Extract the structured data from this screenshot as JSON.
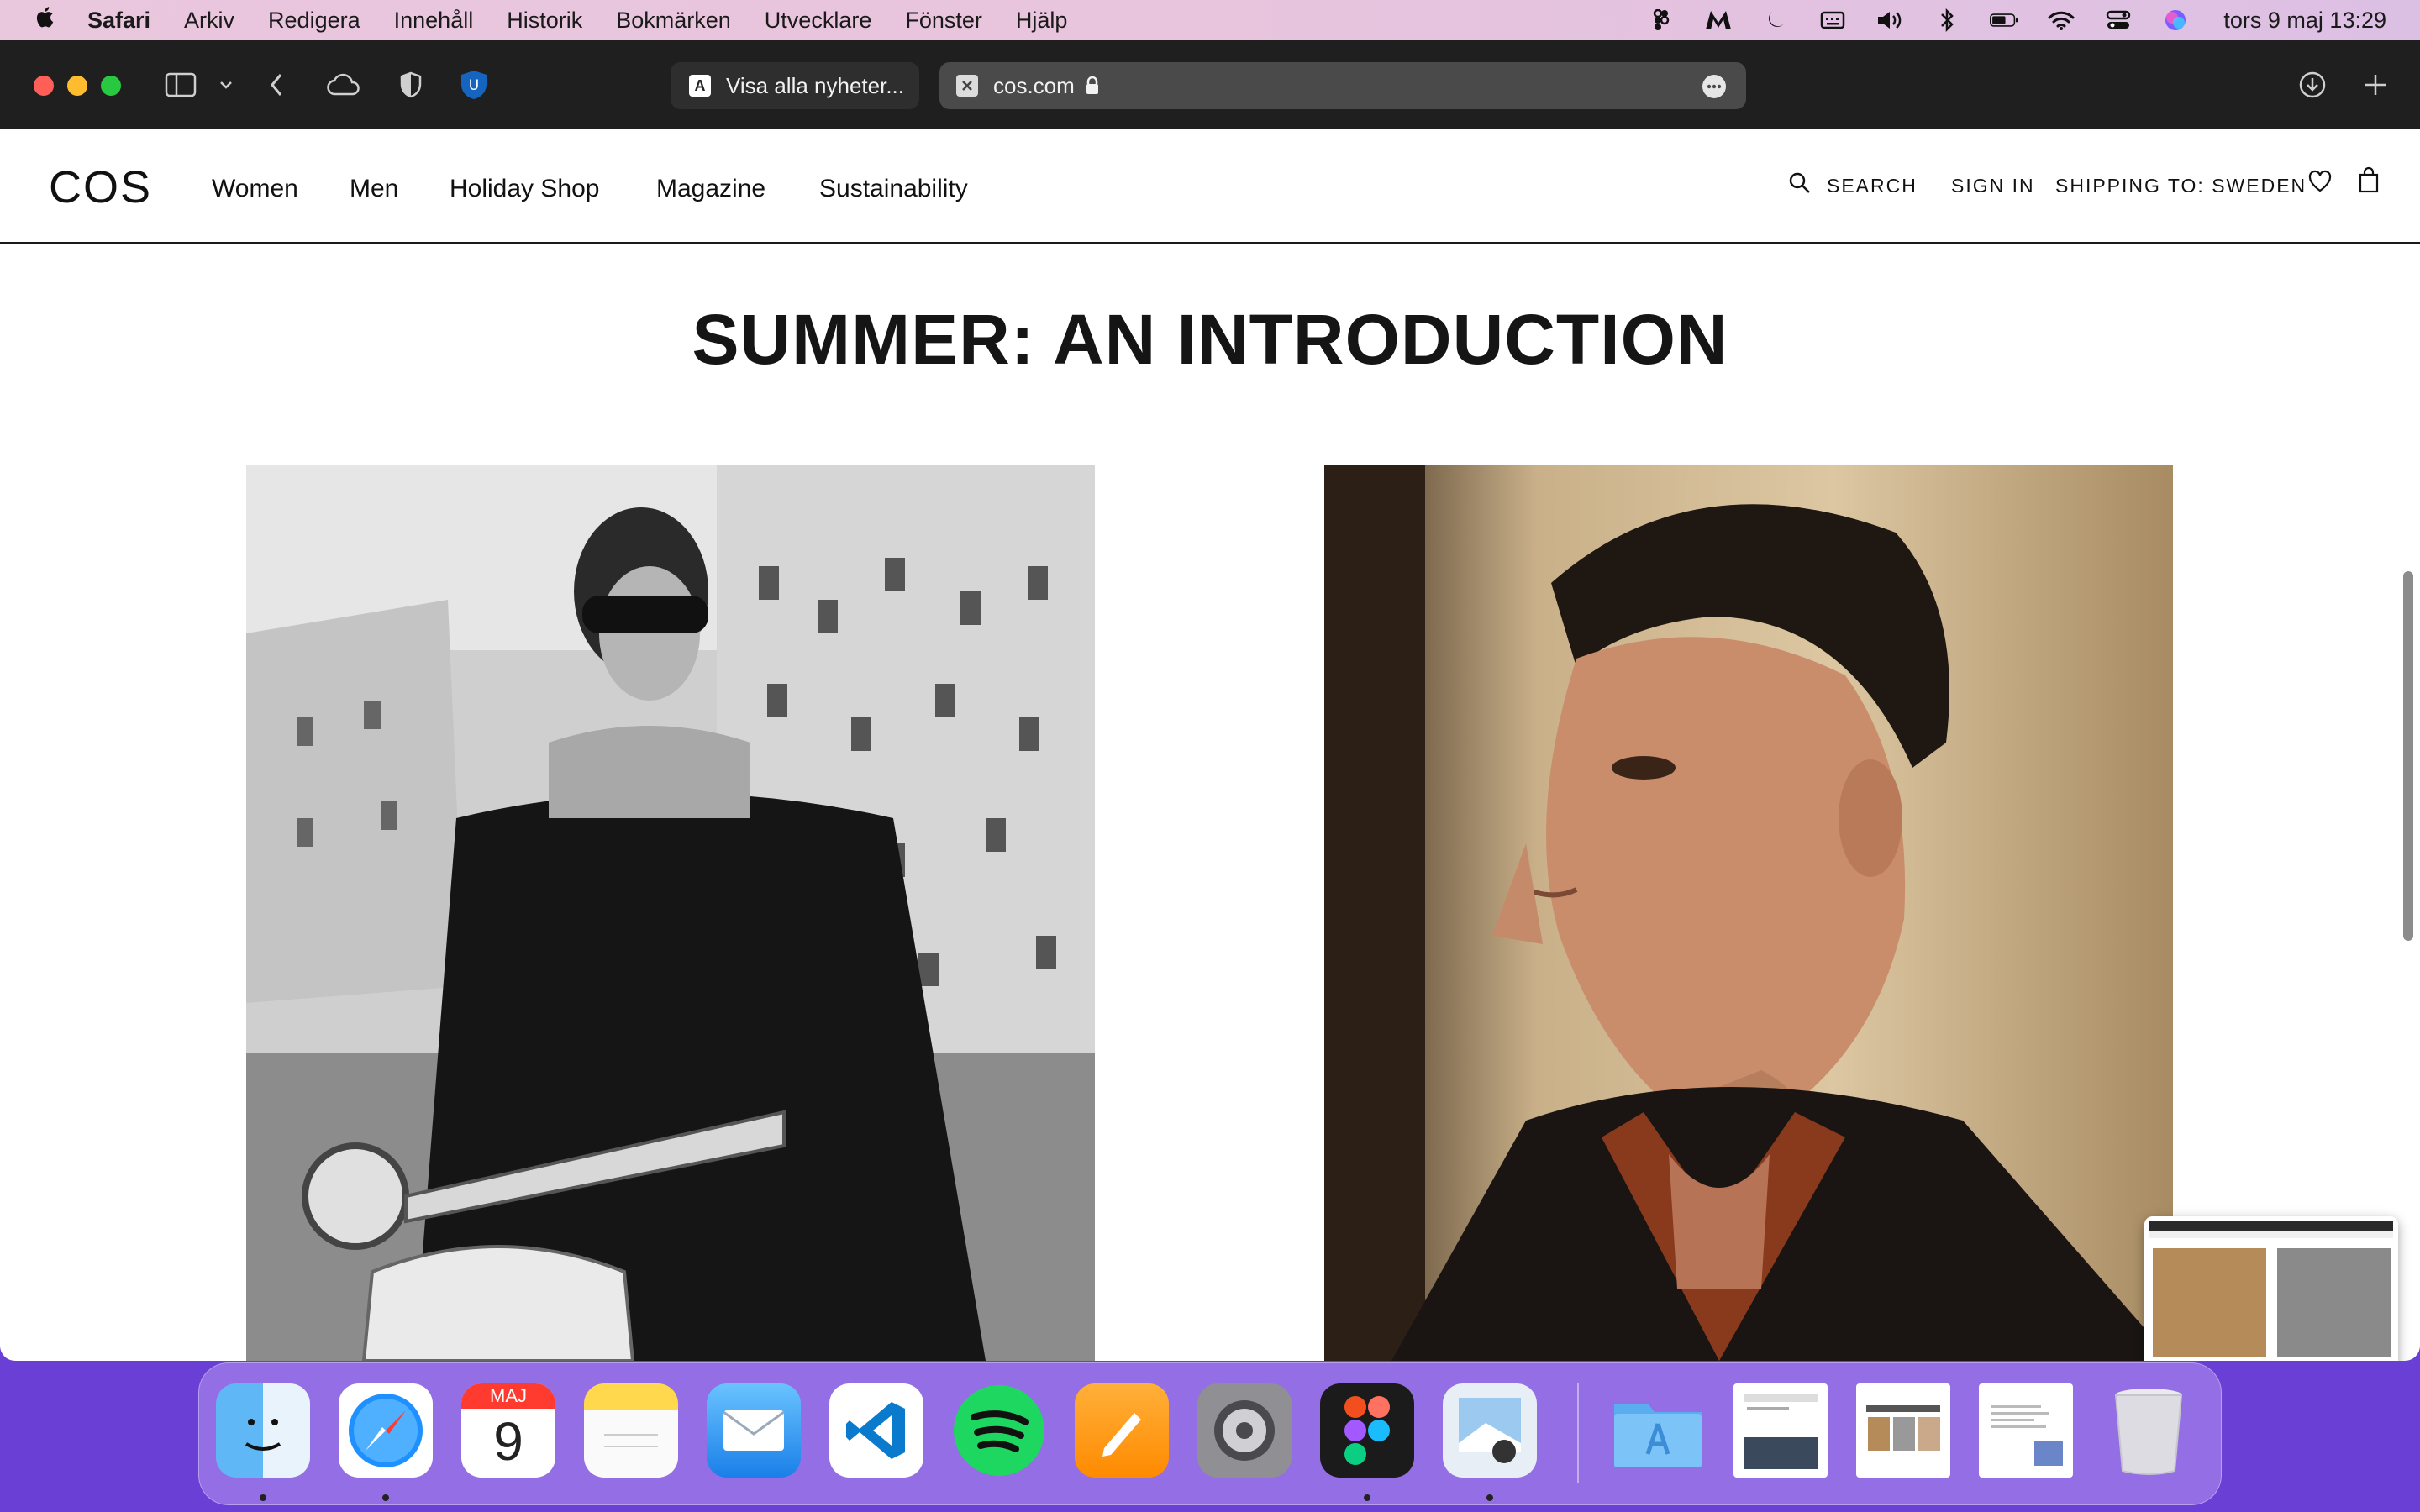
{
  "menubar": {
    "app_name": "Safari",
    "items": [
      "Arkiv",
      "Redigera",
      "Innehåll",
      "Historik",
      "Bokmärken",
      "Utvecklare",
      "Fönster",
      "Hjälp"
    ],
    "clock": "tors 9 maj 13:29"
  },
  "safari": {
    "tab_inactive_title": "Visa alla nyheter...",
    "address": "cos.com",
    "inactive_favicon": "A"
  },
  "site": {
    "logo": "COS",
    "nav": [
      "Women",
      "Men",
      "Holiday Shop",
      "Magazine",
      "Sustainability"
    ],
    "search_label": "SEARCH",
    "signin_label": "SIGN IN",
    "shipping_label": "SHIPPING TO: SWEDEN",
    "page_title": "SUMMER: AN INTRODUCTION"
  },
  "dock": {
    "calendar_month": "MAJ",
    "calendar_day": "9",
    "apps": [
      "finder",
      "safari",
      "calendar",
      "notes",
      "mail",
      "vscode",
      "spotify",
      "pages",
      "system-settings",
      "figma",
      "preview",
      "app-store-folder",
      "screenshot-1",
      "screenshot-2",
      "screenshot-3",
      "trash"
    ]
  },
  "colors": {
    "menubar_bg": "#e8c4dd",
    "toolbar_bg": "#1f1f1f",
    "dock_bg": "#6a3fd6"
  }
}
